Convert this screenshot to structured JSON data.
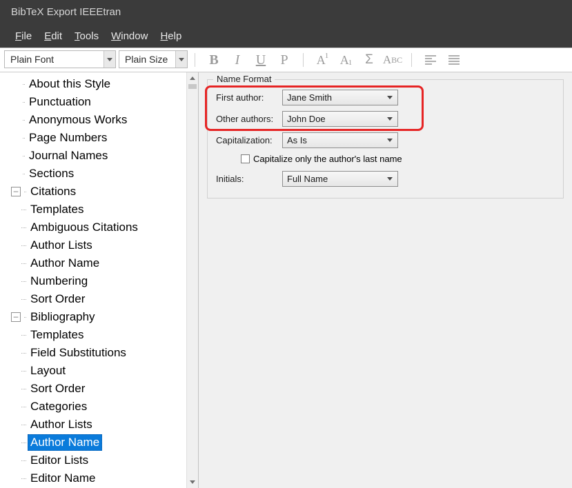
{
  "window": {
    "title": "BibTeX Export IEEEtran"
  },
  "menu": {
    "file": "File",
    "edit": "Edit",
    "tools": "Tools",
    "window": "Window",
    "help": "Help"
  },
  "toolbar": {
    "font": "Plain Font",
    "size": "Plain Size"
  },
  "tree": {
    "top": [
      {
        "label": "About this Style"
      },
      {
        "label": "Punctuation"
      },
      {
        "label": "Anonymous Works"
      },
      {
        "label": "Page Numbers"
      },
      {
        "label": "Journal Names"
      },
      {
        "label": "Sections"
      }
    ],
    "citations": {
      "label": "Citations",
      "children": [
        "Templates",
        "Ambiguous Citations",
        "Author Lists",
        "Author Name",
        "Numbering",
        "Sort Order"
      ]
    },
    "biblio": {
      "label": "Bibliography",
      "children": [
        "Templates",
        "Field Substitutions",
        "Layout",
        "Sort Order",
        "Categories",
        "Author Lists",
        "Author Name",
        "Editor Lists",
        "Editor Name"
      ]
    },
    "selected": "Author Name"
  },
  "form": {
    "group_title": "Name Format",
    "first_author_label": "First author:",
    "first_author_value": "Jane Smith",
    "other_authors_label": "Other authors:",
    "other_authors_value": "John Doe",
    "capitalization_label": "Capitalization:",
    "capitalization_value": "As Is",
    "capitalize_lastname_label": "Capitalize only the author's last name",
    "initials_label": "Initials:",
    "initials_value": "Full Name"
  }
}
